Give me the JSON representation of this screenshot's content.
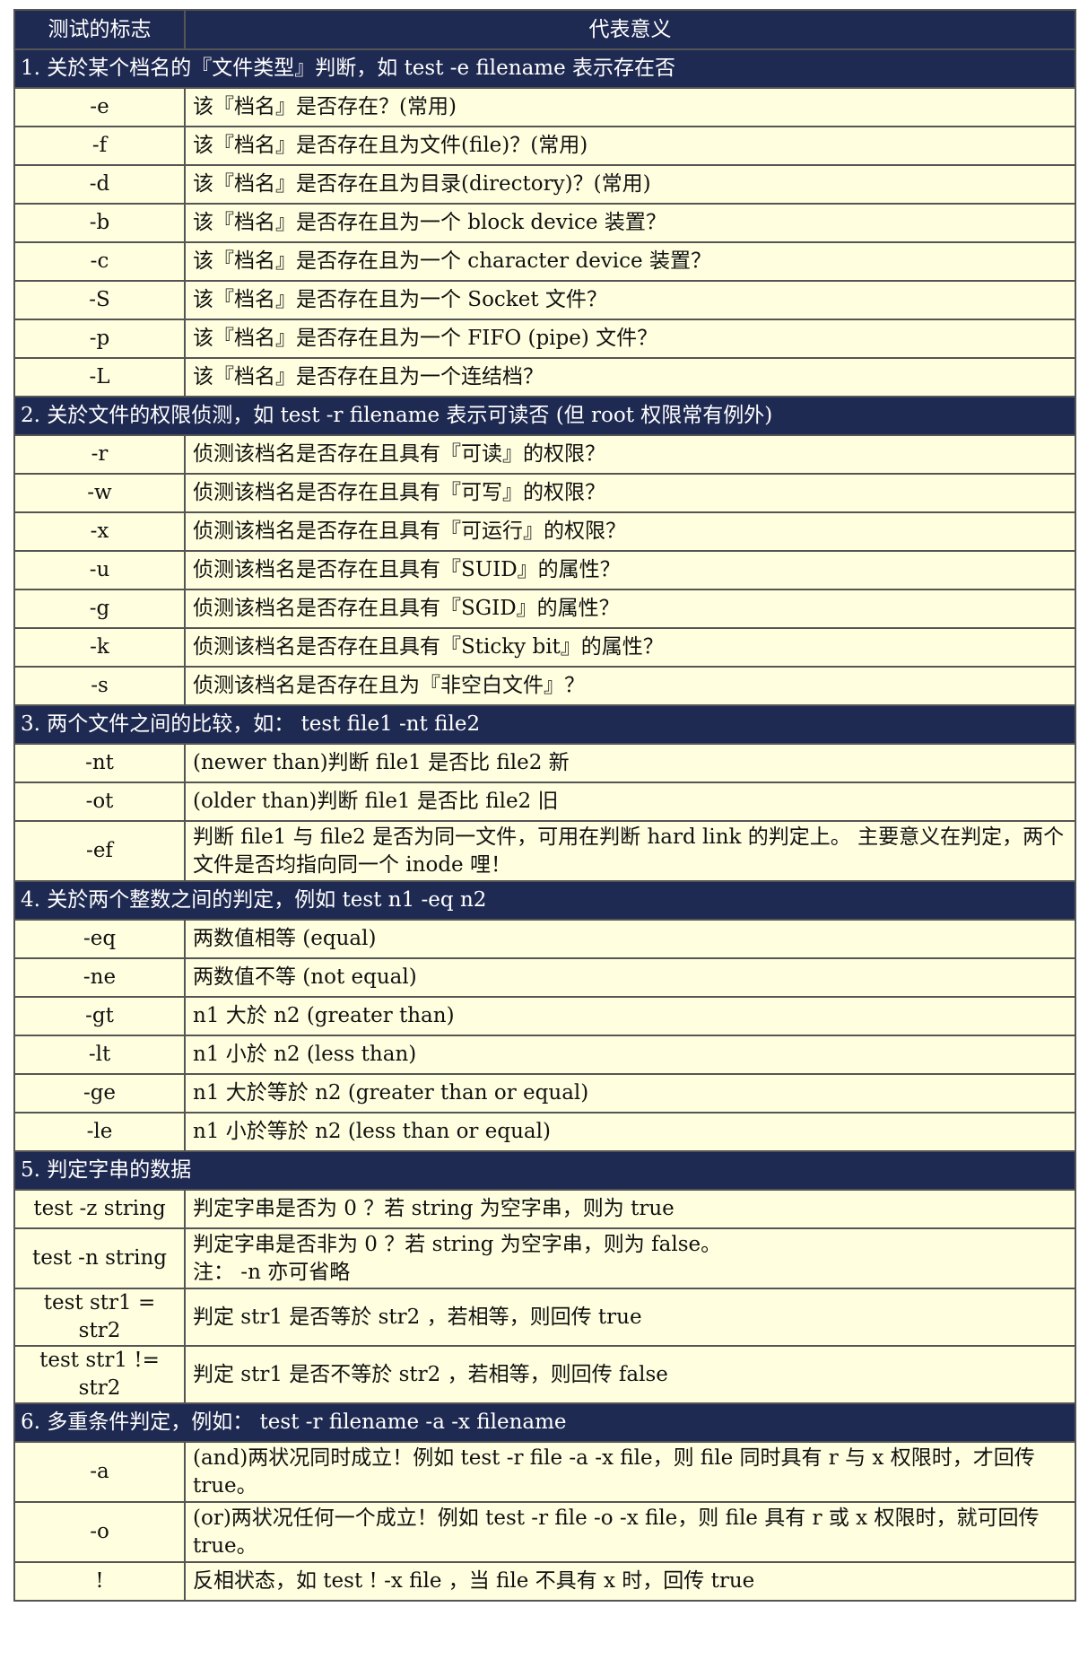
{
  "table": {
    "headers": [
      "测试的标志",
      "代表意义"
    ],
    "sections": [
      {
        "title": "1. 关於某个档名的『文件类型』判断，如 test -e filename 表示存在否",
        "rows": [
          {
            "flag": "-e",
            "desc": "该『档名』是否存在？(常用)"
          },
          {
            "flag": "-f",
            "desc": "该『档名』是否存在且为文件(file)？(常用)"
          },
          {
            "flag": "-d",
            "desc": "该『档名』是否存在且为目录(directory)？(常用)"
          },
          {
            "flag": "-b",
            "desc": "该『档名』是否存在且为一个 block device 装置？"
          },
          {
            "flag": "-c",
            "desc": "该『档名』是否存在且为一个 character device 装置？"
          },
          {
            "flag": "-S",
            "desc": "该『档名』是否存在且为一个 Socket 文件？"
          },
          {
            "flag": "-p",
            "desc": "该『档名』是否存在且为一个 FIFO (pipe) 文件？"
          },
          {
            "flag": "-L",
            "desc": "该『档名』是否存在且为一个连结档？"
          }
        ]
      },
      {
        "title": "2. 关於文件的权限侦测，如 test -r filename 表示可读否 (但 root 权限常有例外)",
        "rows": [
          {
            "flag": "-r",
            "desc": "侦测该档名是否存在且具有『可读』的权限？"
          },
          {
            "flag": "-w",
            "desc": "侦测该档名是否存在且具有『可写』的权限？"
          },
          {
            "flag": "-x",
            "desc": "侦测该档名是否存在且具有『可运行』的权限？"
          },
          {
            "flag": "-u",
            "desc": "侦测该档名是否存在且具有『SUID』的属性？"
          },
          {
            "flag": "-g",
            "desc": "侦测该档名是否存在且具有『SGID』的属性？"
          },
          {
            "flag": "-k",
            "desc": "侦测该档名是否存在且具有『Sticky bit』的属性？"
          },
          {
            "flag": "-s",
            "desc": "侦测该档名是否存在且为『非空白文件』？"
          }
        ]
      },
      {
        "title": "3. 两个文件之间的比较，如： test file1 -nt file2",
        "rows": [
          {
            "flag": "-nt",
            "desc": "(newer than)判断 file1 是否比 file2 新"
          },
          {
            "flag": "-ot",
            "desc": "(older than)判断 file1 是否比 file2 旧"
          },
          {
            "flag": "-ef",
            "desc": "判断 file1 与 file2 是否为同一文件，可用在判断 hard link 的判定上。 主要意义在判定，两个文件是否均指向同一个 inode 哩！",
            "tall": true
          }
        ]
      },
      {
        "title": "4. 关於两个整数之间的判定，例如 test n1 -eq n2",
        "rows": [
          {
            "flag": "-eq",
            "desc": "两数值相等 (equal)"
          },
          {
            "flag": "-ne",
            "desc": "两数值不等 (not equal)"
          },
          {
            "flag": "-gt",
            "desc": "n1 大於 n2 (greater than)"
          },
          {
            "flag": "-lt",
            "desc": "n1 小於 n2 (less than)"
          },
          {
            "flag": "-ge",
            "desc": "n1 大於等於 n2 (greater than or equal)"
          },
          {
            "flag": "-le",
            "desc": "n1 小於等於 n2 (less than or equal)"
          }
        ]
      },
      {
        "title": "5. 判定字串的数据",
        "rows": [
          {
            "flag": "test -z string",
            "desc": "判定字串是否为 0 ？若 string 为空字串，则为 true"
          },
          {
            "flag": "test -n string",
            "desc": "判定字串是否非为 0 ？若 string 为空字串，则为 false。\n注： -n 亦可省略",
            "tall": true
          },
          {
            "flag": "test str1 = str2",
            "desc": "判定 str1 是否等於 str2 ，若相等，则回传 true"
          },
          {
            "flag": "test str1 != str2",
            "desc": "判定 str1 是否不等於 str2 ，若相等，则回传 false"
          }
        ]
      },
      {
        "title": "6. 多重条件判定，例如： test -r filename -a -x filename",
        "rows": [
          {
            "flag": "-a",
            "desc": "(and)两状况同时成立！例如 test -r file -a -x file，则 file 同时具有 r 与 x 权限时，才回传 true。",
            "tall": true
          },
          {
            "flag": "-o",
            "desc": "(or)两状况任何一个成立！例如 test -r file -o -x file，则 file 具有 r 或 x 权限时，就可回传 true。",
            "tall": true
          },
          {
            "flag": "!",
            "desc": "反相状态，如 test ! -x file ，当 file 不具有 x 时，回传 true"
          }
        ]
      }
    ]
  }
}
